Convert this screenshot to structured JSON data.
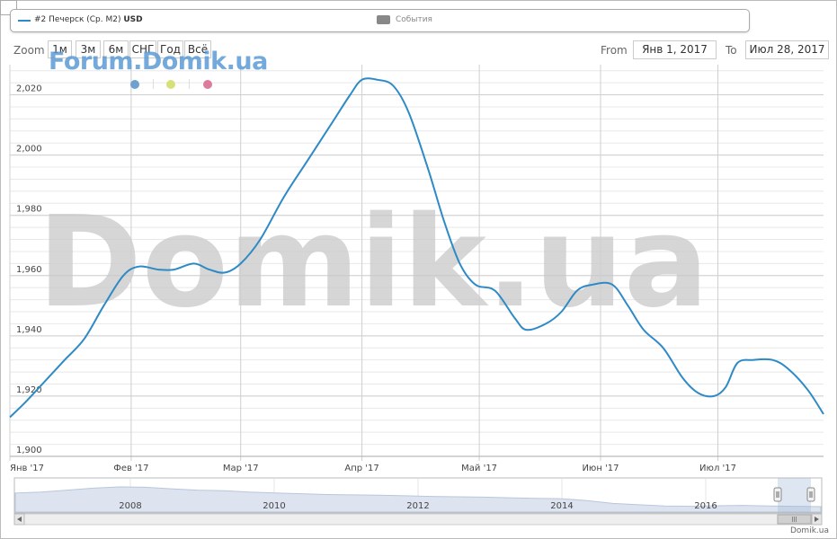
{
  "legend": {
    "series_name": "#2 Печерск (Ср. М2)",
    "series_unit": "USD",
    "events_label": "События"
  },
  "range_selector": {
    "zoom_label": "Zoom",
    "buttons": [
      "1м",
      "3м",
      "6м",
      "СНГ",
      "Год",
      "Всё"
    ],
    "from_label": "From",
    "from_value": "Янв 1, 2017",
    "to_label": "To",
    "to_value": "Июл 28, 2017"
  },
  "watermark": {
    "forum": "Forum.Domik.ua",
    "big": "Domik.ua"
  },
  "credit": "Domik.ua",
  "colors": {
    "series": "#2e8ac6",
    "grid": "#d8d8d8",
    "dot_blue": "#6fa0d0",
    "dot_yellow": "#d8e07a",
    "dot_pink": "#dd7b9b"
  },
  "chart_data": {
    "type": "line",
    "ylim": [
      1900,
      2030
    ],
    "y_ticks": [
      1900,
      1920,
      1940,
      1960,
      1980,
      2000,
      2020
    ],
    "y_tick_labels": [
      "1,900",
      "1,920",
      "1,940",
      "1,960",
      "1,980",
      "2,000",
      "2,020"
    ],
    "x_tick_labels": [
      "Янв '17",
      "Фев '17",
      "Мар '17",
      "Апр '17",
      "Май '17",
      "Июн '17",
      "Июл '17"
    ],
    "x_tick_dates": [
      "2017-01-01",
      "2017-02-01",
      "2017-03-01",
      "2017-04-01",
      "2017-05-01",
      "2017-06-01",
      "2017-07-01"
    ],
    "x_range": [
      "2017-01-01",
      "2017-07-28"
    ],
    "series": [
      {
        "points": [
          {
            "x": "2017-01-01",
            "y": 1913
          },
          {
            "x": "2017-01-05",
            "y": 1918
          },
          {
            "x": "2017-01-10",
            "y": 1925
          },
          {
            "x": "2017-01-15",
            "y": 1932
          },
          {
            "x": "2017-01-20",
            "y": 1939
          },
          {
            "x": "2017-01-25",
            "y": 1950
          },
          {
            "x": "2017-01-30",
            "y": 1960
          },
          {
            "x": "2017-02-03",
            "y": 1963
          },
          {
            "x": "2017-02-08",
            "y": 1962
          },
          {
            "x": "2017-02-12",
            "y": 1962
          },
          {
            "x": "2017-02-17",
            "y": 1964
          },
          {
            "x": "2017-02-21",
            "y": 1962
          },
          {
            "x": "2017-02-25",
            "y": 1961
          },
          {
            "x": "2017-03-01",
            "y": 1964
          },
          {
            "x": "2017-03-06",
            "y": 1972
          },
          {
            "x": "2017-03-12",
            "y": 1986
          },
          {
            "x": "2017-03-18",
            "y": 1998
          },
          {
            "x": "2017-03-24",
            "y": 2010
          },
          {
            "x": "2017-03-29",
            "y": 2020
          },
          {
            "x": "2017-04-01",
            "y": 2025
          },
          {
            "x": "2017-04-05",
            "y": 2025
          },
          {
            "x": "2017-04-09",
            "y": 2023
          },
          {
            "x": "2017-04-13",
            "y": 2014
          },
          {
            "x": "2017-04-18",
            "y": 1995
          },
          {
            "x": "2017-04-22",
            "y": 1978
          },
          {
            "x": "2017-04-26",
            "y": 1964
          },
          {
            "x": "2017-04-30",
            "y": 1957
          },
          {
            "x": "2017-05-05",
            "y": 1955
          },
          {
            "x": "2017-05-10",
            "y": 1946
          },
          {
            "x": "2017-05-13",
            "y": 1942
          },
          {
            "x": "2017-05-18",
            "y": 1944
          },
          {
            "x": "2017-05-22",
            "y": 1948
          },
          {
            "x": "2017-05-26",
            "y": 1955
          },
          {
            "x": "2017-05-30",
            "y": 1957
          },
          {
            "x": "2017-06-04",
            "y": 1957
          },
          {
            "x": "2017-06-08",
            "y": 1950
          },
          {
            "x": "2017-06-12",
            "y": 1942
          },
          {
            "x": "2017-06-17",
            "y": 1936
          },
          {
            "x": "2017-06-22",
            "y": 1926
          },
          {
            "x": "2017-06-26",
            "y": 1921
          },
          {
            "x": "2017-06-30",
            "y": 1920
          },
          {
            "x": "2017-07-03",
            "y": 1923
          },
          {
            "x": "2017-07-06",
            "y": 1931
          },
          {
            "x": "2017-07-10",
            "y": 1932
          },
          {
            "x": "2017-07-15",
            "y": 1932
          },
          {
            "x": "2017-07-19",
            "y": 1929
          },
          {
            "x": "2017-07-24",
            "y": 1922
          },
          {
            "x": "2017-07-28",
            "y": 1914
          }
        ]
      }
    ]
  },
  "navigator": {
    "year_labels": [
      "2008",
      "2010",
      "2012",
      "2014",
      "2016"
    ],
    "year_values": [
      2008,
      2010,
      2012,
      2014,
      2016
    ],
    "year_range": [
      2006.4,
      2017.6
    ],
    "selection_years": [
      2017.0,
      2017.58
    ],
    "history_values": [
      1.0,
      1.05,
      1.15,
      1.25,
      1.32,
      1.3,
      1.22,
      1.15,
      1.12,
      1.05,
      1.0,
      0.96,
      0.92,
      0.9,
      0.88,
      0.85,
      0.82,
      0.8,
      0.78,
      0.75,
      0.72,
      0.7,
      0.6,
      0.45,
      0.38,
      0.32,
      0.3,
      0.33,
      0.35,
      0.32,
      0.3,
      0.28
    ]
  }
}
